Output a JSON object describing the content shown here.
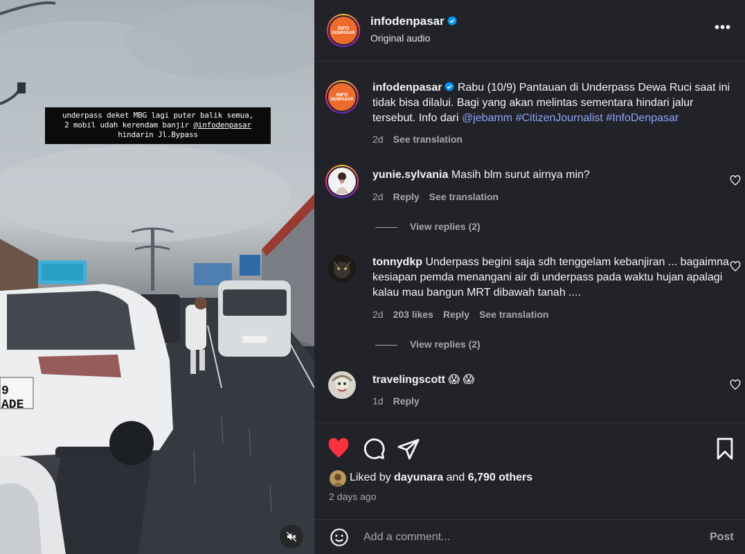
{
  "video": {
    "caption_line1": "underpass deket MBG lagi puter balik semua,",
    "caption_line2_prefix": "2 mobil udah kerendam banjir ",
    "caption_mention": "@infodenpasar",
    "caption_line3": "hindarin Jl.Bypass",
    "plate_text": "9 ADE",
    "mute_icon": "speaker-muted-icon"
  },
  "header": {
    "username": "infodenpasar",
    "subtitle": "Original audio",
    "more_label": "•••",
    "logo_line1": "INFO",
    "logo_line2": "DENPASAR"
  },
  "caption_post": {
    "username": "infodenpasar",
    "text": "Rabu (10/9) Pantauan di Underpass Dewa Ruci saat ini tidak bisa dilalui. Bagi yang akan melintas sementara hindari jalur tersebut. Info dari ",
    "tags": "@jebamm #CitizenJournalist #InfoDenpasar",
    "time": "2d",
    "translate": "See translation"
  },
  "comments": [
    {
      "username": "yunie.sylvania",
      "text": "Masih blm surut airnya min?",
      "time": "2d",
      "reply": "Reply",
      "translate": "See translation",
      "view_replies": "View replies (2)"
    },
    {
      "username": "tonnydkp",
      "text": "Underpass begini saja sdh tenggelam kebanjiran ... bagaimna kesiapan pemda menangani air di underpass pada waktu hujan apalagi kalau mau bangun MRT dibawah tanah ....",
      "time": "2d",
      "likes": "203 likes",
      "reply": "Reply",
      "translate": "See translation",
      "view_replies": "View replies (2)"
    },
    {
      "username": "travelingscott",
      "text": "😱 😱",
      "time": "1d",
      "reply": "Reply"
    }
  ],
  "actions": {
    "liked_prefix": "Liked by ",
    "liked_user": "dayunara",
    "liked_and": " and ",
    "liked_count": "6,790 others",
    "ago": "2 days ago",
    "like_color": "#ff3040"
  },
  "composer": {
    "placeholder": "Add a comment...",
    "post_label": "Post"
  }
}
